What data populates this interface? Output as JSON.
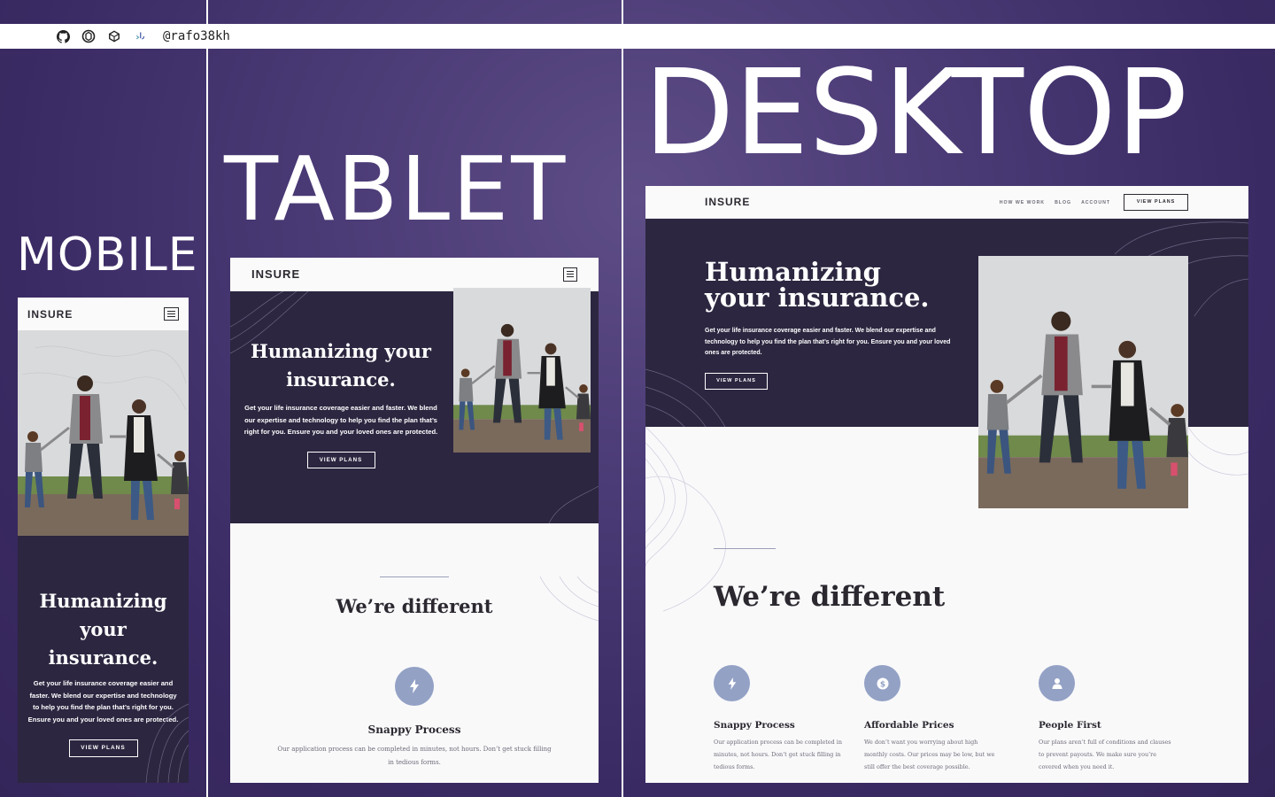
{
  "topbar": {
    "icons": [
      "github-icon",
      "codepen-icon",
      "codesandbox-icon",
      "frontend-mentor-icon"
    ],
    "handle": "@rafo38kh"
  },
  "labels": {
    "mobile": "MOBILE",
    "tablet": "TABLET",
    "desktop": "DESKTOP"
  },
  "site": {
    "logo": "INSURE",
    "nav": [
      "HOW WE WORK",
      "BLOG",
      "ACCOUNT"
    ],
    "nav_button": "VIEW PLANS",
    "hero": {
      "title": "Humanizing your insurance.",
      "title_line1": "Humanizing",
      "title_line2": "your insurance.",
      "tablet_line1": "Humanizing your",
      "tablet_line2": "insurance.",
      "description": "Get your life insurance coverage easier and faster. We blend our expertise and technology to help you find the plan that’s right for you. Ensure you and your loved ones are protected.",
      "button": "VIEW PLANS"
    },
    "different": {
      "heading": "We’re different",
      "features": [
        {
          "icon": "lightning-icon",
          "title": "Snappy Process",
          "description": "Our application process can be completed in minutes, not hours. Don’t get stuck filling in tedious forms."
        },
        {
          "icon": "dollar-icon",
          "title": "Affordable Prices",
          "description": "We don’t want you worrying about high monthly costs. Our prices may be low, but we still offer the best coverage possible."
        },
        {
          "icon": "person-icon",
          "title": "People First",
          "description": "Our plans aren’t full of conditions and clauses to prevent payouts. We make sure you’re covered when you need it."
        }
      ]
    }
  },
  "colors": {
    "background": "#4a3a75",
    "hero_dark": "#2c2640",
    "icon_circle": "#93a1c5",
    "light": "#f9f9fa"
  }
}
